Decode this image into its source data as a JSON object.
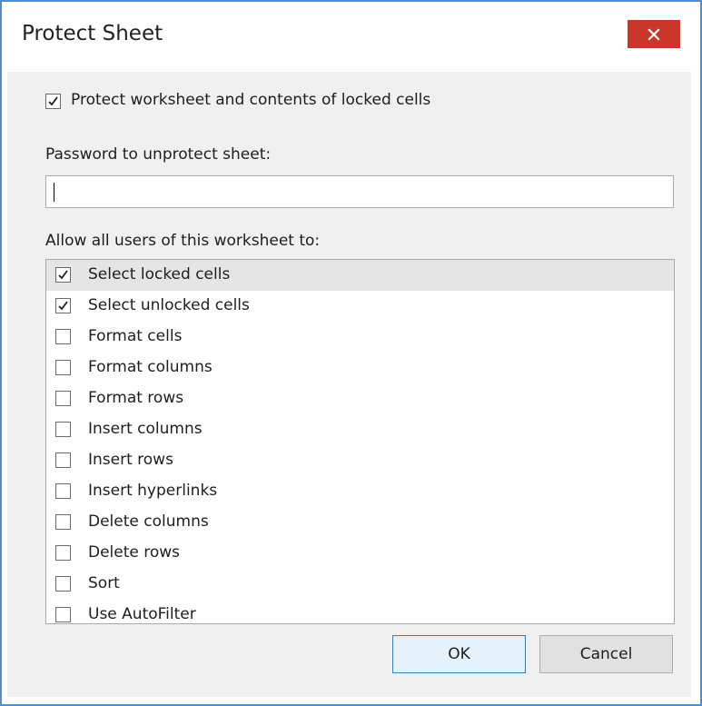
{
  "dialog": {
    "title": "Protect Sheet",
    "close_icon": "close-icon",
    "protect_label": "Protect worksheet and contents of locked cells",
    "protect_checked": true,
    "password_label": "Password to unprotect sheet:",
    "password_value": "",
    "allow_label": "Allow all users of this worksheet to:",
    "permissions": [
      {
        "label": "Select locked cells",
        "checked": true,
        "selected": true
      },
      {
        "label": "Select unlocked cells",
        "checked": true,
        "selected": false
      },
      {
        "label": "Format cells",
        "checked": false,
        "selected": false
      },
      {
        "label": "Format columns",
        "checked": false,
        "selected": false
      },
      {
        "label": "Format rows",
        "checked": false,
        "selected": false
      },
      {
        "label": "Insert columns",
        "checked": false,
        "selected": false
      },
      {
        "label": "Insert rows",
        "checked": false,
        "selected": false
      },
      {
        "label": "Insert hyperlinks",
        "checked": false,
        "selected": false
      },
      {
        "label": "Delete columns",
        "checked": false,
        "selected": false
      },
      {
        "label": "Delete rows",
        "checked": false,
        "selected": false
      },
      {
        "label": "Sort",
        "checked": false,
        "selected": false
      },
      {
        "label": "Use AutoFilter",
        "checked": false,
        "selected": false
      }
    ],
    "ok_label": "OK",
    "cancel_label": "Cancel"
  },
  "colors": {
    "accent_border": "#4a8fd6",
    "close_button": "#c9362c",
    "selected_row": "#e5e5e5"
  }
}
